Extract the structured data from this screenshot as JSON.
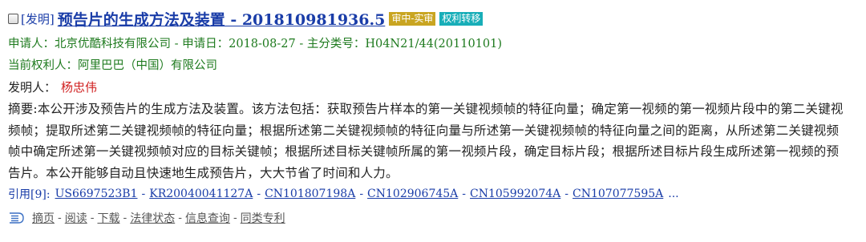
{
  "patent": {
    "type_tag": "[发明]",
    "title": "预告片的生成方法及装置 - 201810981936.5",
    "badges": [
      "审中-实审",
      "权利转移"
    ],
    "applicant_line": "申请人：北京优酷科技有限公司 - 申请日：2018-08-27 - 主分类号：H04N21/44(20110101)",
    "current_owner_line": "当前权利人：阿里巴巴（中国）有限公司",
    "inventor_label": "发明人：",
    "inventor_name": "杨忠伟",
    "abstract": "摘要:本公开涉及预告片的生成方法及装置。该方法包括：获取预告片样本的第一关键视频帧的特征向量；确定第一视频的第一视频片段中的第二关键视频帧；提取所述第二关键视频帧的特征向量；根据所述第二关键视频帧的特征向量与所述第一关键视频帧的特征向量之间的距离，从所述第二关键视频帧中确定所述第一关键视频帧对应的目标关键帧；根据所述目标关键帧所属的第一视频片段，确定目标片段；根据所述目标片段生成所述第一视频的预告片。本公开能够自动且快速地生成预告片，大大节省了时间和人力。",
    "citations_label": "引用[9]:",
    "citations": [
      "US6697523B1",
      "KR20040041127A",
      "CN101807198A",
      "CN102906745A",
      "CN105992074A",
      "CN107077595A"
    ],
    "citations_more": "...",
    "actions": [
      "摘页",
      "阅读",
      "下载",
      "法律状态",
      "信息查询",
      "同类专利"
    ]
  },
  "colors": {
    "link": "#1a3da8",
    "meta_green": "#1e7a1e",
    "inventor_red": "#d02020",
    "badge_pending": "#c9a521",
    "badge_transfer": "#18aeb8"
  },
  "icons": [
    "checkbox",
    "menu-list-icon"
  ]
}
